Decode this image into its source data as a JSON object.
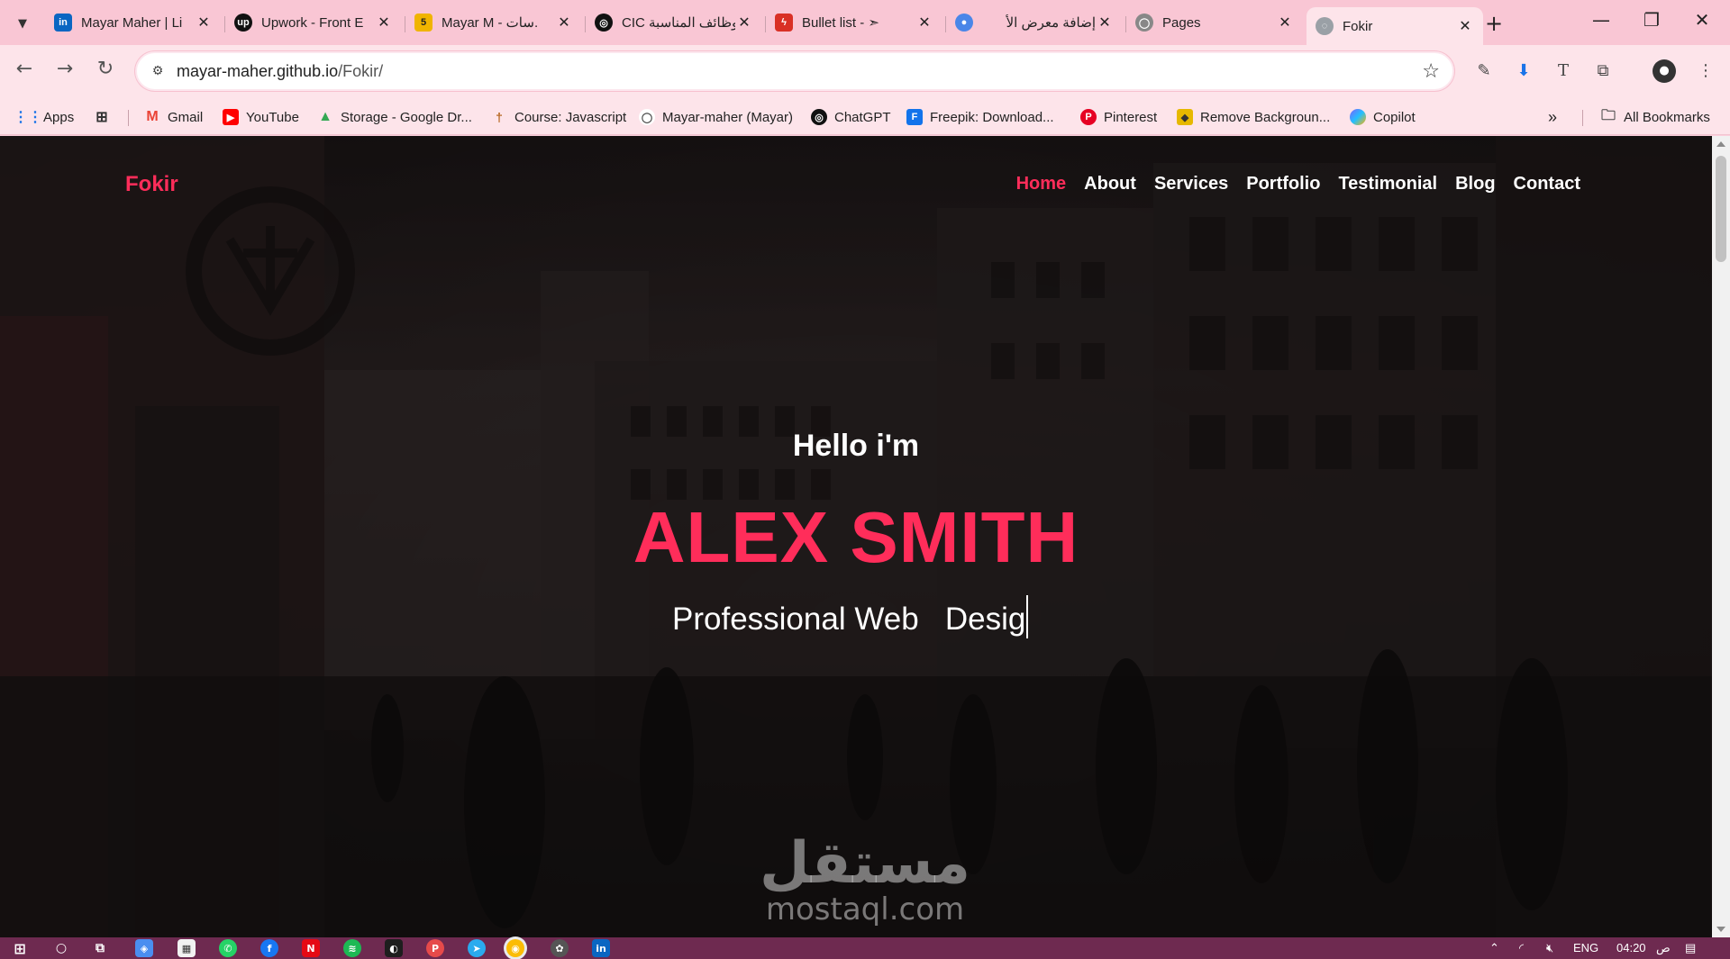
{
  "browser": {
    "tabs": [
      {
        "title": "Mayar Maher | Li",
        "favicon": "linkedin-icon",
        "color": "#0a66c2",
        "glyph": "in"
      },
      {
        "title": "Upwork - Front E",
        "favicon": "upwork-icon",
        "color": "#111111",
        "glyph": "up"
      },
      {
        "title": "Mayar M - سات.",
        "favicon": "mostaql-icon",
        "color": "#f0b400",
        "glyph": "5"
      },
      {
        "title": "CIC الوظائف المناسبة",
        "favicon": "openai-icon",
        "color": "#111111",
        "glyph": "◎"
      },
      {
        "title": "Bullet list - ➣",
        "favicon": "pdf-icon",
        "color": "#d93025",
        "glyph": "ϟ"
      },
      {
        "title": "إضافة معرض الأ",
        "favicon": "circle-icon",
        "color": "#4a86e8",
        "glyph": "●"
      },
      {
        "title": "Pages",
        "favicon": "github-icon",
        "color": "#888888",
        "glyph": "◯"
      },
      {
        "title": "Fokir",
        "favicon": "globe-icon",
        "color": "#9aa0a6",
        "glyph": "◌"
      }
    ],
    "url_host": "mayar-maher.github.io",
    "url_path": "/Fokir/",
    "bookmarks": [
      {
        "label": "Apps",
        "icon": "apps-grid-icon",
        "color": "#1a73e8"
      },
      {
        "label": "",
        "icon": "grid-icon",
        "color": "#333333"
      },
      {
        "label": "Gmail",
        "icon": "gmail-icon",
        "color": "#ea4335"
      },
      {
        "label": "YouTube",
        "icon": "youtube-icon",
        "color": "#ff0000"
      },
      {
        "label": "Storage - Google Dr...",
        "icon": "drive-icon",
        "color": "#34a853"
      },
      {
        "label": "Course: Javascript",
        "icon": "course-icon",
        "color": "#b5651d"
      },
      {
        "label": "Mayar-maher (Mayar)",
        "icon": "github-icon",
        "color": "#ffffff"
      },
      {
        "label": "ChatGPT",
        "icon": "openai-icon",
        "color": "#111111"
      },
      {
        "label": "Freepik: Download...",
        "icon": "freepik-icon",
        "color": "#1273eb"
      },
      {
        "label": "Pinterest",
        "icon": "pinterest-icon",
        "color": "#e60023"
      },
      {
        "label": "Remove Backgroun...",
        "icon": "removebg-icon",
        "color": "#e6b800"
      },
      {
        "label": "Copilot",
        "icon": "copilot-icon",
        "color": "#7b61ff"
      }
    ],
    "all_bookmarks_label": "All Bookmarks"
  },
  "site": {
    "logo": "Fokir",
    "nav": [
      "Home",
      "About",
      "Services",
      "Portfolio",
      "Testimonial",
      "Blog",
      "Contact"
    ],
    "active_nav": "Home",
    "hero": {
      "greeting": "Hello i'm",
      "name": "ALEX SMITH",
      "role": "Professional Web   Desig"
    },
    "accent_color": "#ff2d5a"
  },
  "watermark": {
    "arabic": "مستقل",
    "english": "mostaql.com"
  },
  "taskbar": {
    "language": "ENG",
    "time": "04:20",
    "period": "ص"
  }
}
